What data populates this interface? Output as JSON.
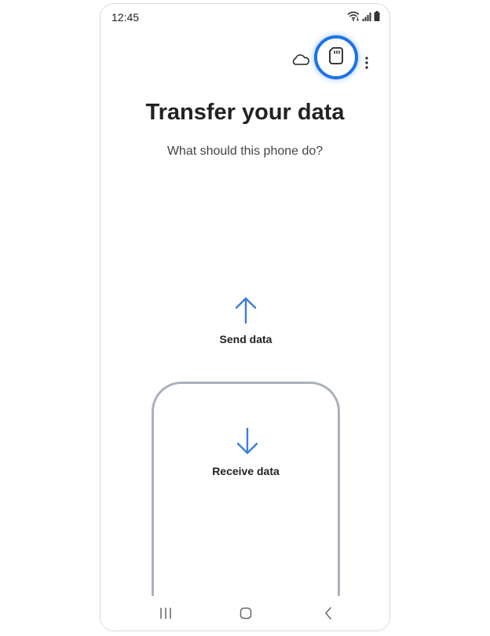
{
  "status_bar": {
    "time": "12:45",
    "icons": [
      "wifi-icon",
      "signal-icon",
      "battery-icon"
    ]
  },
  "action_bar": {
    "cloud_icon": "cloud-icon",
    "sd_card_icon": "sd-card-icon",
    "more_icon": "more-options-icon",
    "highlight_color": "#1a73e8"
  },
  "main": {
    "title": "Transfer your data",
    "subtitle": "What should this phone do?",
    "options": [
      {
        "label": "Send data",
        "icon": "arrow-up-icon",
        "selected": false
      },
      {
        "label": "Receive data",
        "icon": "arrow-down-icon",
        "selected": true
      }
    ],
    "accent_color": "#3b7ddd"
  },
  "nav_bar": {
    "icons": [
      "recents-icon",
      "home-icon",
      "back-icon"
    ]
  }
}
